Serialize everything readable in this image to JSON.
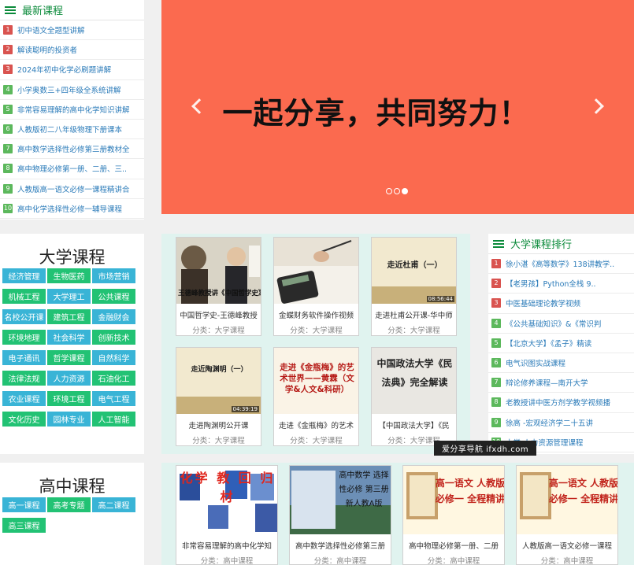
{
  "latest": {
    "title": "最新课程",
    "items": [
      {
        "n": "1",
        "t": "初中语文全题型讲解",
        "c": "red"
      },
      {
        "n": "2",
        "t": "解读聪明的投资者",
        "c": "red"
      },
      {
        "n": "3",
        "t": "2024年初中化学必刷题讲解",
        "c": "red"
      },
      {
        "n": "4",
        "t": "小学奥数三+四年级全系统讲解",
        "c": "grn"
      },
      {
        "n": "5",
        "t": "非常容易理解的高中化学知识讲解",
        "c": "grn"
      },
      {
        "n": "6",
        "t": "人教版初二八年级物理下册课本",
        "c": "grn"
      },
      {
        "n": "7",
        "t": "高中数学选择性必修第三册教材全",
        "c": "grn"
      },
      {
        "n": "8",
        "t": "高中物理必修第一册、二册、三..",
        "c": "grn"
      },
      {
        "n": "9",
        "t": "人教版高一语文必修一课程精讲合",
        "c": "grn"
      },
      {
        "n": "10",
        "t": "高中化学选择性必修一辅导课程",
        "c": "grn"
      }
    ]
  },
  "banner": {
    "text": "一起分享，共同努力！"
  },
  "university": {
    "title": "大学课程",
    "tags": [
      {
        "t": "经济管理",
        "c": "b"
      },
      {
        "t": "生物医药",
        "c": "g"
      },
      {
        "t": "市场营销",
        "c": "b"
      },
      {
        "t": "机械工程",
        "c": "g"
      },
      {
        "t": "大学理工",
        "c": "b"
      },
      {
        "t": "公共课程",
        "c": "g"
      },
      {
        "t": "名校公开课",
        "c": "b"
      },
      {
        "t": "建筑工程",
        "c": "g"
      },
      {
        "t": "金融财会",
        "c": "b"
      },
      {
        "t": "环境地理",
        "c": "g"
      },
      {
        "t": "社会科学",
        "c": "b"
      },
      {
        "t": "创新技术",
        "c": "g"
      },
      {
        "t": "电子通讯",
        "c": "b"
      },
      {
        "t": "哲学课程",
        "c": "g"
      },
      {
        "t": "自然科学",
        "c": "b"
      },
      {
        "t": "法律法规",
        "c": "g"
      },
      {
        "t": "人力资源",
        "c": "b"
      },
      {
        "t": "石油化工",
        "c": "g"
      },
      {
        "t": "农业课程",
        "c": "b"
      },
      {
        "t": "环境工程",
        "c": "g"
      },
      {
        "t": "电气工程",
        "c": "b"
      },
      {
        "t": "文化历史",
        "c": "g"
      },
      {
        "t": "园林专业",
        "c": "b"
      },
      {
        "t": "人工智能",
        "c": "g"
      }
    ]
  },
  "highschool": {
    "title": "高中课程",
    "tags": [
      {
        "t": "高一课程",
        "c": "b"
      },
      {
        "t": "高考专题",
        "c": "g"
      },
      {
        "t": "高二课程",
        "c": "b"
      },
      {
        "t": "高三课程",
        "c": "g"
      }
    ]
  },
  "uni_cards": [
    {
      "title": "中国哲学史-王德峰教授",
      "meta": "分类：大学课程",
      "thumb": "王德峰教授讲《中国哲学史》"
    },
    {
      "title": "金蝶财务软件操作视频",
      "meta": "分类：大学课程",
      "thumb": ""
    },
    {
      "title": "走进杜甫公开课-华中师",
      "meta": "分类：大学课程",
      "thumb": "走近杜甫（一）",
      "dur": "08:56:44"
    },
    {
      "title": "走进陶渊明公开课",
      "meta": "分类：大学课程",
      "thumb": "走近陶渊明（一）",
      "dur": "04:39:19"
    },
    {
      "title": "走进《金瓶梅》的艺术",
      "meta": "分类：大学课程",
      "thumb": "走进《金瓶梅》的艺术世界——黄霖（文学&人文&科研）"
    },
    {
      "title": "【中国政法大学】《民",
      "meta": "分类：大学课程",
      "thumb": "中国政法大学《民法典》完全解读"
    }
  ],
  "ranking": {
    "title": "大学课程排行",
    "items": [
      {
        "n": "1",
        "t": "徐小湛《高等数学》138讲教学..",
        "c": "red"
      },
      {
        "n": "2",
        "t": "【老男孩】Python全栈 9..",
        "c": "red"
      },
      {
        "n": "3",
        "t": "中医基础理论教学视频",
        "c": "red"
      },
      {
        "n": "4",
        "t": "《公共基础知识》&《常识判",
        "c": "grn"
      },
      {
        "n": "5",
        "t": "【北京大学】《孟子》精读",
        "c": "grn"
      },
      {
        "n": "6",
        "t": "电气识图实战课程",
        "c": "grn"
      },
      {
        "n": "7",
        "t": "辩论修养课程—南开大学",
        "c": "grn"
      },
      {
        "n": "8",
        "t": "老教授讲中医方剂学教学视频播",
        "c": "grn"
      },
      {
        "n": "9",
        "t": "徐高 -宏观经济学二十五讲",
        "c": "grn"
      },
      {
        "n": "10",
        "t": "大学-人力资源管理课程",
        "c": "grn"
      }
    ]
  },
  "hs_cards": [
    {
      "title": "非常容易理解的高中化学知",
      "meta": "分类：高中课程",
      "thumb": "化学 教 回 归 材"
    },
    {
      "title": "高中数学选择性必修第三册",
      "meta": "分类：高中课程",
      "thumb": "高中数学 选择性必修 第三册 新人教A版"
    },
    {
      "title": "高中物理必修第一册、二册",
      "meta": "分类：高中课程",
      "thumb": "高一语文 人教版 必修一 全程精讲"
    },
    {
      "title": "人教版高一语文必修一课程",
      "meta": "分类：高中课程",
      "thumb": "高一语文 人教版 必修一 全程精讲"
    }
  ],
  "watermark": "爱分享导航 ifxdh.com",
  "colors": {
    "accent": "#0a8a3a",
    "banner": "#fb6a4f",
    "tagBlue": "#39b4d6",
    "tagGreen": "#22c274",
    "rankRed": "#d9534f",
    "rankGreen": "#5cb85c"
  }
}
